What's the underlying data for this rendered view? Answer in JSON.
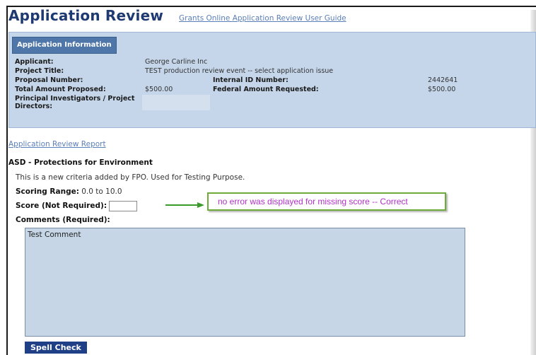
{
  "header": {
    "title": "Application Review",
    "guide_link": "Grants Online Application Review User Guide"
  },
  "info": {
    "tab_label": "Application Information",
    "applicant_label": "Applicant:",
    "applicant_value": "George Carline Inc",
    "project_title_label": "Project Title:",
    "project_title_value": "TEST production review event -- select application issue",
    "proposal_number_label": "Proposal Number:",
    "proposal_number_value": "",
    "internal_id_label": "Internal ID Number:",
    "internal_id_value": "2442641",
    "total_amount_label": "Total Amount Proposed:",
    "total_amount_value": "$500.00",
    "federal_amount_label": "Federal Amount Requested:",
    "federal_amount_value": "$500.00",
    "pi_label": "Principal Investigators / Project Directors:",
    "pi_value": ""
  },
  "report_link": "Application Review Report",
  "criterion": {
    "title": "ASD - Protections for Environment",
    "description": "This is a new criteria added by FPO. Used for Testing Purpose.",
    "range_label": "Scoring Range:",
    "range_value": "0.0 to 10.0",
    "score_label": "Score (Not Required):",
    "score_value": "",
    "comments_label": "Comments (Required):",
    "comments_value": "Test Comment"
  },
  "annotation": {
    "callout_text": "no error was displayed for missing score -- Correct",
    "arrow_color": "#3a9a2a",
    "border_color": "#6dac3a",
    "text_color": "#b030c8"
  },
  "buttons": {
    "spell_check": "Spell Check"
  }
}
